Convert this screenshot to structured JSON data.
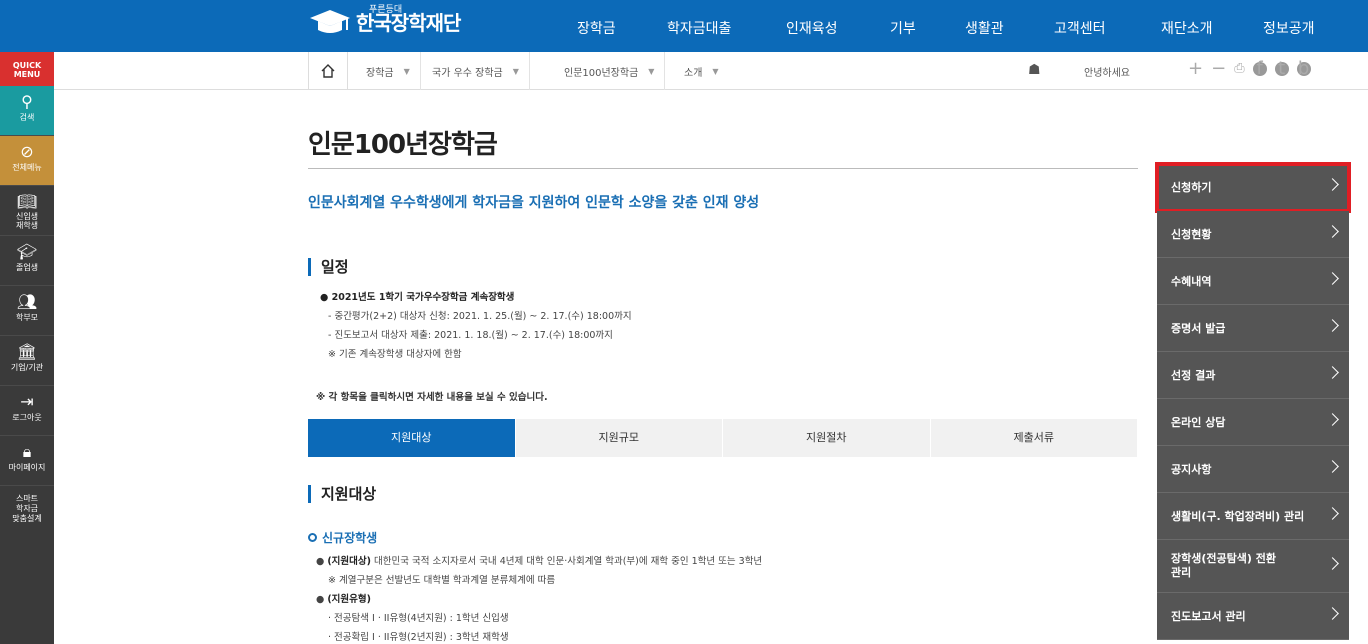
{
  "header": {
    "logo_small": "푸른등대",
    "logo_text": "한국장학재단",
    "nav": [
      "장학금",
      "학자금대출",
      "인재육성",
      "기부",
      "생활관",
      "고객센터",
      "재단소개",
      "정보공개"
    ]
  },
  "breadcrumb": [
    "장학금",
    "국가 우수 장학금",
    "인문100년장학금",
    "소개"
  ],
  "greeting": "안녕하세요",
  "quickmenu": {
    "title_line1": "QUICK",
    "title_line2": "MENU",
    "items": [
      "검색",
      "전체메뉴",
      "신입생\n재학생",
      "졸업생",
      "학부모",
      "기업/기관",
      "로그아웃",
      "마이페이지",
      "스마트\n학자금\n맞춤설계"
    ]
  },
  "page": {
    "title": "인문100년장학금",
    "lead": "인문사회계열 우수학생에게 학자금을 지원하여 인문학 소양을 갖춘 인재 양성",
    "schedule_title": "일정",
    "schedule_head": "● 2021년도 1학기 국가우수장학금 계속장학생",
    "schedule_1": "- 중간평가(2+2) 대상자 신청: 2021. 1. 25.(월) ~ 2. 17.(수) 18:00까지",
    "schedule_2": "- 진도보고서 대상자 제출: 2021. 1. 18.(월) ~ 2. 17.(수) 18:00까지",
    "schedule_3": "※ 기존 계속장학생 대상자에 한함",
    "notice": "※ 각 항목을 클릭하시면 자세한 내용을 보실 수 있습니다.",
    "tabs": [
      "지원대상",
      "지원규모",
      "지원절차",
      "제출서류"
    ],
    "target_title": "지원대상",
    "new_title": "신규장학생",
    "t1_label": "(지원대상)",
    "t1_text": " 대한민국 국적 소지자로서 국내 4년제 대학 인문·사회계열 학과(부)에 재학 중인 1학년 또는 3학년",
    "t1_note": "※ 계열구분은 선발년도 대학별 학과계열 분류체계에 따름",
    "t2_label": "(지원유형)",
    "t2_1": "· 전공탐색 I · II유형(4년지원) : 1학년 신입생",
    "t2_2": "· 전공확립 I · II유형(2년지원) : 3학년 재학생"
  },
  "side_menu": [
    "신청하기",
    "신청현황",
    "수혜내역",
    "증명서 발급",
    "선정 결과",
    "온라인 상담",
    "공지사항",
    "생활비(구. 학업장려비) 관리",
    "장학생(전공탐색) 전환\n관리",
    "진도보고서 관리"
  ],
  "colors": {
    "primary": "#0c6ab8",
    "highlight": "#e01e24",
    "quick_bg": "#3a3a3a",
    "menu_bg": "#555555"
  }
}
